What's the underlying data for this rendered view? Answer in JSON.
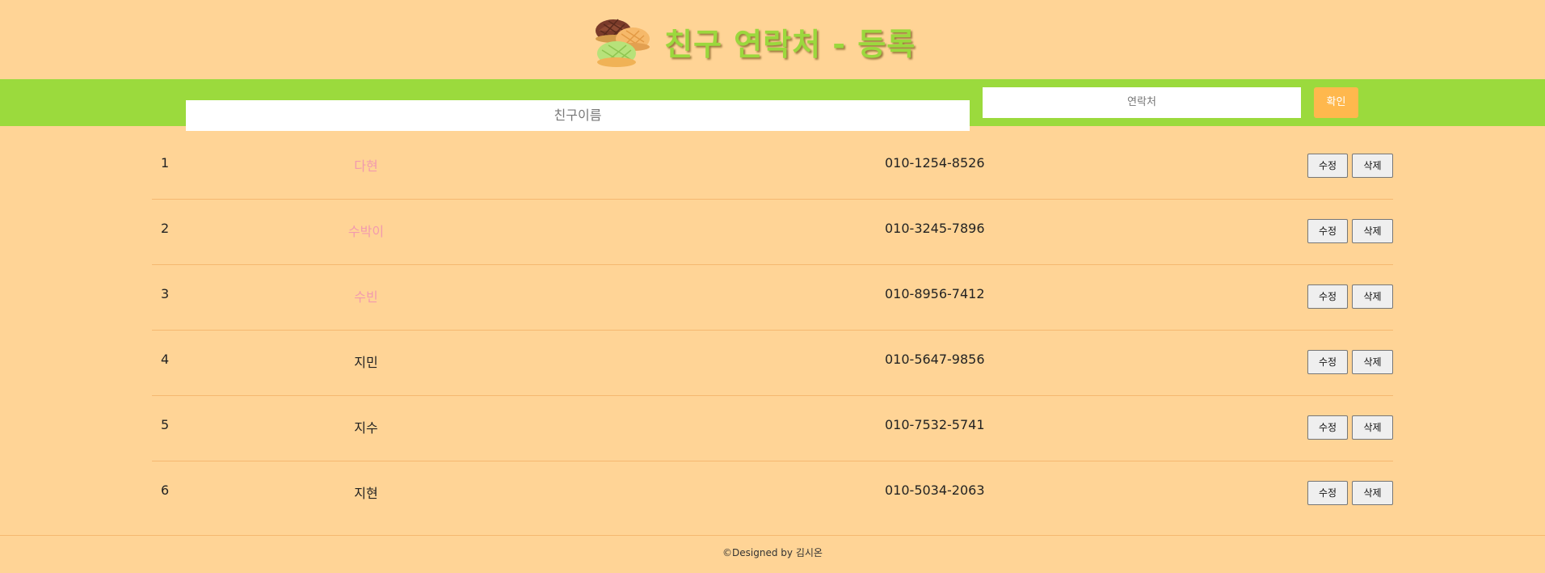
{
  "header": {
    "logo_icon": "melon-bread-icon",
    "title": "친구 연락처 - 등록",
    "title_color": "#9BD83D"
  },
  "form": {
    "name_placeholder": "친구이름",
    "phone_placeholder": "연락처",
    "confirm_label": "확인",
    "bar_color": "#9BDA3D",
    "confirm_color": "#FFB84D"
  },
  "contacts": [
    {
      "num": "1",
      "name": "다현",
      "phone": "010-1254-8526",
      "highlight": true
    },
    {
      "num": "2",
      "name": "수박이",
      "phone": "010-3245-7896",
      "highlight": true
    },
    {
      "num": "3",
      "name": "수빈",
      "phone": "010-8956-7412",
      "highlight": true
    },
    {
      "num": "4",
      "name": "지민",
      "phone": "010-5647-9856",
      "highlight": false
    },
    {
      "num": "5",
      "name": "지수",
      "phone": "010-7532-5741",
      "highlight": false
    },
    {
      "num": "6",
      "name": "지현",
      "phone": "010-5034-2063",
      "highlight": false
    }
  ],
  "row_actions": {
    "edit_label": "수정",
    "delete_label": "삭제"
  },
  "footer": {
    "text": "©Designed by 김시온"
  },
  "colors": {
    "background": "#FFD496",
    "highlight_name": "#F29AAE"
  }
}
